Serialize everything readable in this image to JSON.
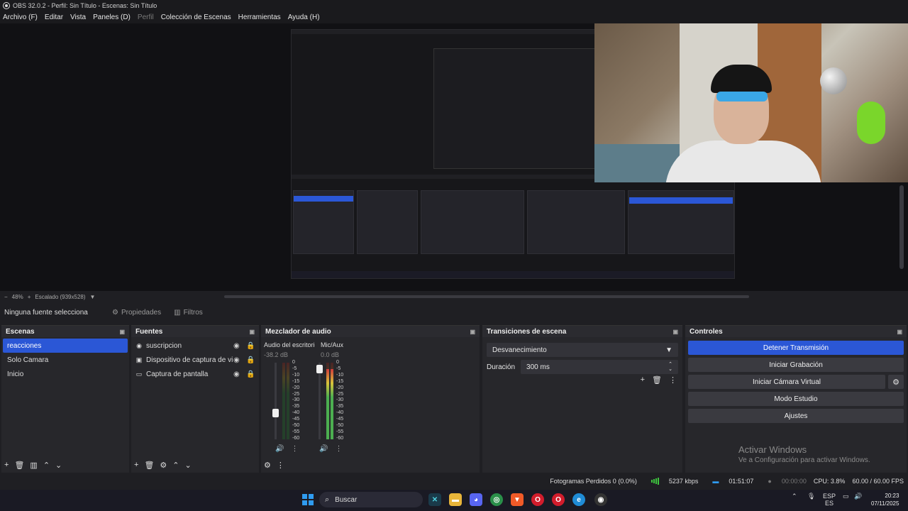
{
  "window": {
    "title": "OBS 32.0.2 - Perfil: Sin Título - Escenas: Sin Título"
  },
  "menu": [
    {
      "label": "Archivo (F)",
      "enabled": true
    },
    {
      "label": "Editar",
      "enabled": true
    },
    {
      "label": "Vista",
      "enabled": true
    },
    {
      "label": "Paneles (D)",
      "enabled": true
    },
    {
      "label": "Perfil",
      "enabled": false
    },
    {
      "label": "Colección de Escenas",
      "enabled": true
    },
    {
      "label": "Herramientas",
      "enabled": true
    },
    {
      "label": "Ayuda (H)",
      "enabled": true
    }
  ],
  "preview": {
    "zoom": "48%",
    "scale_label": "Escalado (939x528)"
  },
  "source_toolbar": {
    "no_source": "Ninguna fuente selecciona",
    "properties": "Propiedades",
    "filters": "Filtros"
  },
  "scenes": {
    "title": "Escenas",
    "items": [
      {
        "label": "reacciones",
        "active": true
      },
      {
        "label": "Solo Camara",
        "active": false
      },
      {
        "label": "Inicio",
        "active": false
      }
    ]
  },
  "sources": {
    "title": "Fuentes",
    "items": [
      {
        "label": "suscripcion",
        "icon": "media-icon"
      },
      {
        "label": "Dispositivo de captura de vide",
        "icon": "camera-icon"
      },
      {
        "label": "Captura de pantalla",
        "icon": "monitor-icon"
      }
    ]
  },
  "mixer": {
    "title": "Mezclador de audio",
    "channels": [
      {
        "name": "Audio del escritoric",
        "db": "-38.2 dB",
        "level": 0.0,
        "fader": 0.32
      },
      {
        "name": "Mic/Aux",
        "db": "0.0 dB",
        "level": 0.92,
        "fader": 0.97
      }
    ],
    "ticks": [
      "0",
      "-5",
      "-10",
      "-15",
      "-20",
      "-25",
      "-30",
      "-35",
      "-40",
      "-45",
      "-50",
      "-55",
      "-60"
    ]
  },
  "transitions": {
    "title": "Transiciones de escena",
    "selected": "Desvanecimiento",
    "duration_label": "Duración",
    "duration_value": "300 ms"
  },
  "controls": {
    "title": "Controles",
    "stop_stream": "Detener Transmisión",
    "start_record": "Iniciar Grabación",
    "start_virtual_cam": "Iniciar Cámara Virtual",
    "studio_mode": "Modo Estudio",
    "settings": "Ajustes"
  },
  "watermark": {
    "line1": "Activar Windows",
    "line2": "Ve a Configuración para activar Windows."
  },
  "status": {
    "dropped_frames": "Fotogramas Perdidos 0 (0.0%)",
    "bitrate": "5237 kbps",
    "stream_time": "01:51:07",
    "record_time": "00:00:00",
    "cpu": "CPU: 3.8%",
    "fps": "60.00 / 60.00 FPS"
  },
  "taskbar": {
    "search_placeholder": "Buscar",
    "lang_top": "ESP",
    "lang_bottom": "ES",
    "time": "20:23",
    "date": "07/11/2025"
  },
  "colors": {
    "accent": "#2b57d6",
    "panel": "#27272b",
    "background": "#1f1f23"
  }
}
